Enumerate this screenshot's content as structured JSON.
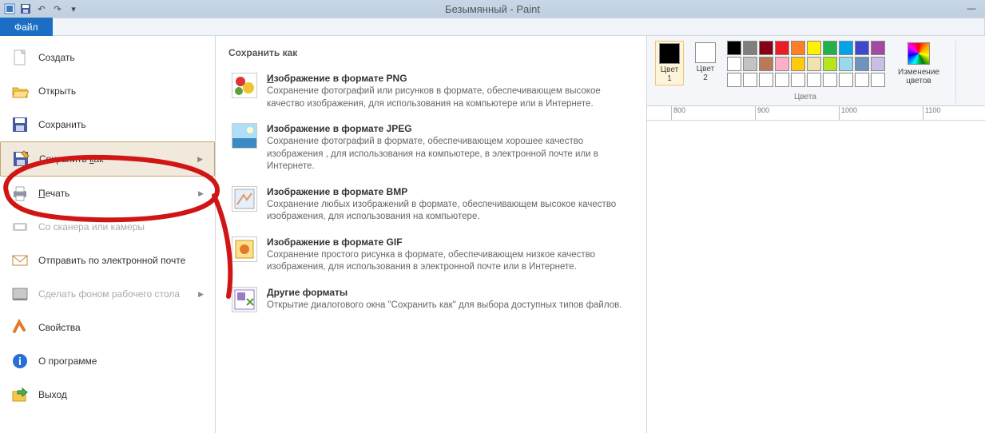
{
  "window": {
    "title": "Безымянный - Paint",
    "minimize": "—"
  },
  "qat": {
    "undo": "↶",
    "redo": "↷",
    "down": "▾",
    "save_icon": ""
  },
  "file_tab": "Файл",
  "filemenu": [
    {
      "key": "new",
      "label": "Создать",
      "disabled": false,
      "arrow": false
    },
    {
      "key": "open",
      "label": "Открыть",
      "disabled": false,
      "arrow": false
    },
    {
      "key": "save",
      "label": "Сохранить",
      "disabled": false,
      "arrow": false
    },
    {
      "key": "saveas",
      "label": "Сохранить как",
      "disabled": false,
      "arrow": true,
      "highlight": true,
      "u": "к"
    },
    {
      "key": "print",
      "label": "Печать",
      "disabled": false,
      "arrow": true,
      "u": "П"
    },
    {
      "key": "scanner",
      "label": "Со сканера или камеры",
      "disabled": true,
      "arrow": false
    },
    {
      "key": "email",
      "label": "Отправить по электронной почте",
      "disabled": false,
      "arrow": false
    },
    {
      "key": "wallpaper",
      "label": "Сделать фоном рабочего стола",
      "disabled": true,
      "arrow": true
    },
    {
      "key": "props",
      "label": "Свойства",
      "disabled": false,
      "arrow": false
    },
    {
      "key": "about",
      "label": "О программе",
      "disabled": false,
      "arrow": false
    },
    {
      "key": "exit",
      "label": "Выход",
      "disabled": false,
      "arrow": false
    }
  ],
  "submenu": {
    "title": "Сохранить как",
    "items": [
      {
        "key": "png",
        "u": "И",
        "label": "Изображение в формате PNG",
        "desc": "Сохранение фотографий или рисунков в формате, обеспечивающем высокое качество изображения, для использования на компьютере или в Интернете."
      },
      {
        "key": "jpeg",
        "u": "",
        "label": "Изображение в формате JPEG",
        "desc": "Сохранение фотографий в формате, обеспечивающем хорошее качество изображения , для использования на компьютере, в электронной почте или в Интернете."
      },
      {
        "key": "bmp",
        "u": "",
        "label": "Изображение в формате BMP",
        "desc": "Сохранение любых изображений в формате, обеспечивающем высокое качество изображения, для использования на компьютере."
      },
      {
        "key": "gif",
        "u": "",
        "label": "Изображение в формате GIF",
        "desc": "Сохранение простого рисунка в формате, обеспечивающем низкое качество изображения, для использования в электронной почте или в Интернете."
      },
      {
        "key": "other",
        "u": "Д",
        "label": "Другие форматы",
        "desc": "Открытие диалогового окна \"Сохранить как\" для выбора доступных типов файлов."
      }
    ]
  },
  "colors": {
    "color1_label": "Цвет\n1",
    "color2_label": "Цвет\n2",
    "color1": "#000000",
    "color2": "#ffffff",
    "edit_label": "Изменение\nцветов",
    "group_label": "Цвета",
    "row1": [
      "#000000",
      "#7f7f7f",
      "#880015",
      "#ed1c24",
      "#ff7f27",
      "#fff200",
      "#22b14c",
      "#00a2e8",
      "#3f48cc",
      "#a349a4"
    ],
    "row2": [
      "#ffffff",
      "#c3c3c3",
      "#b97a57",
      "#ffaec9",
      "#ffc90e",
      "#efe4b0",
      "#b5e61d",
      "#99d9ea",
      "#7092be",
      "#c8bfe7"
    ]
  },
  "ruler": {
    "ticks": [
      "800",
      "900",
      "1000",
      "1100"
    ]
  }
}
